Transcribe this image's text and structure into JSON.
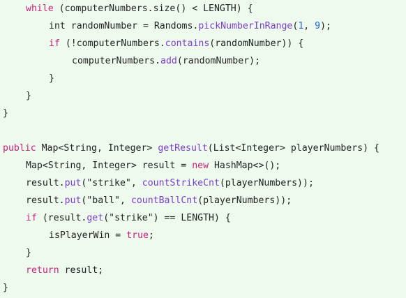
{
  "code": {
    "l1": {
      "kw_while": "while",
      "rest": " (computerNumbers.size() < LENGTH) {"
    },
    "l2": {
      "a": "int randomNumber = Randoms.",
      "fn": "pickNumberInRange",
      "b": "(",
      "n1": "1",
      "c": ", ",
      "n2": "9",
      "d": ");"
    },
    "l3": {
      "kw_if": "if",
      "a": " (!computerNumbers.",
      "fn": "contains",
      "b": "(randomNumber)) {"
    },
    "l4": {
      "a": "computerNumbers.",
      "fn": "add",
      "b": "(randomNumber);"
    },
    "l5": {
      "text": "}"
    },
    "l6": {
      "text": "}"
    },
    "l7": {
      "text": "}"
    },
    "l8": {
      "kw_public": "public",
      "a": " Map<String, Integer> ",
      "fn": "getResult",
      "b": "(List<Integer> playerNumbers) {"
    },
    "l9": {
      "a": "Map<String, Integer> result = ",
      "kw_new": "new",
      "b": " HashMap<>();"
    },
    "l10": {
      "a": "result.",
      "fn": "put",
      "b": "(\"strike\", ",
      "fn2": "countStrikeCnt",
      "c": "(playerNumbers));"
    },
    "l11": {
      "a": "result.",
      "fn": "put",
      "b": "(\"ball\", ",
      "fn2": "countBallCnt",
      "c": "(playerNumbers));"
    },
    "l12": {
      "kw_if": "if",
      "a": " (result.",
      "fn": "get",
      "b": "(\"strike\") == LENGTH) {"
    },
    "l13": {
      "a": "isPlayerWin = ",
      "kw_true": "true",
      "b": ";"
    },
    "l14": {
      "text": "}"
    },
    "l15": {
      "kw_return": "return",
      "a": " result;"
    },
    "l16": {
      "text": "}"
    }
  },
  "colors": {
    "background": "#eefaee",
    "keyword": "#c8207a",
    "function": "#7a3ed1",
    "number": "#1f63d6",
    "text": "#222222"
  }
}
